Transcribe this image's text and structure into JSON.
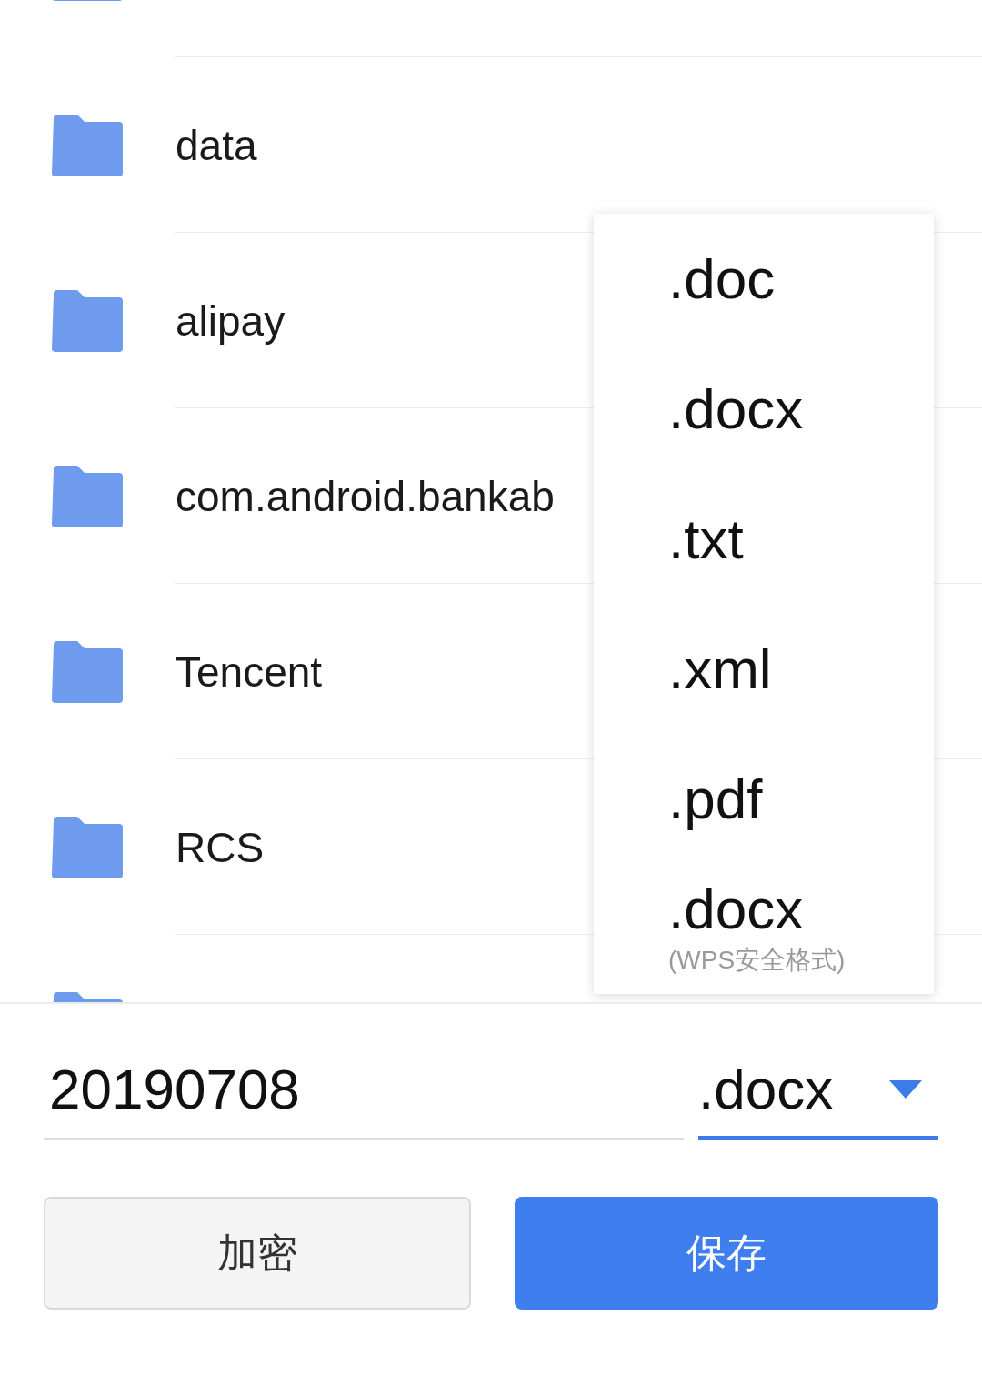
{
  "folders": [
    {
      "kind": "folder"
    },
    {
      "kind": "folder",
      "name": "data"
    },
    {
      "kind": "folder",
      "name": "alipay"
    },
    {
      "kind": "folder",
      "name": "com.android.bankab"
    },
    {
      "kind": "folder",
      "name": "Tencent"
    },
    {
      "kind": "folder",
      "name": "RCS"
    },
    {
      "kind": "folder"
    }
  ],
  "format_menu": {
    "options": [
      {
        "label": ".doc"
      },
      {
        "label": ".docx"
      },
      {
        "label": ".txt"
      },
      {
        "label": ".xml"
      },
      {
        "label": ".pdf"
      },
      {
        "label": ".docx",
        "note": "(WPS安全格式)"
      }
    ]
  },
  "file_name": {
    "value": "20190708"
  },
  "format_select": {
    "value": ".docx",
    "expanded": true
  },
  "buttons": [
    {
      "label": "加密",
      "kind": "secondary"
    },
    {
      "label": "保存",
      "kind": "primary"
    }
  ]
}
